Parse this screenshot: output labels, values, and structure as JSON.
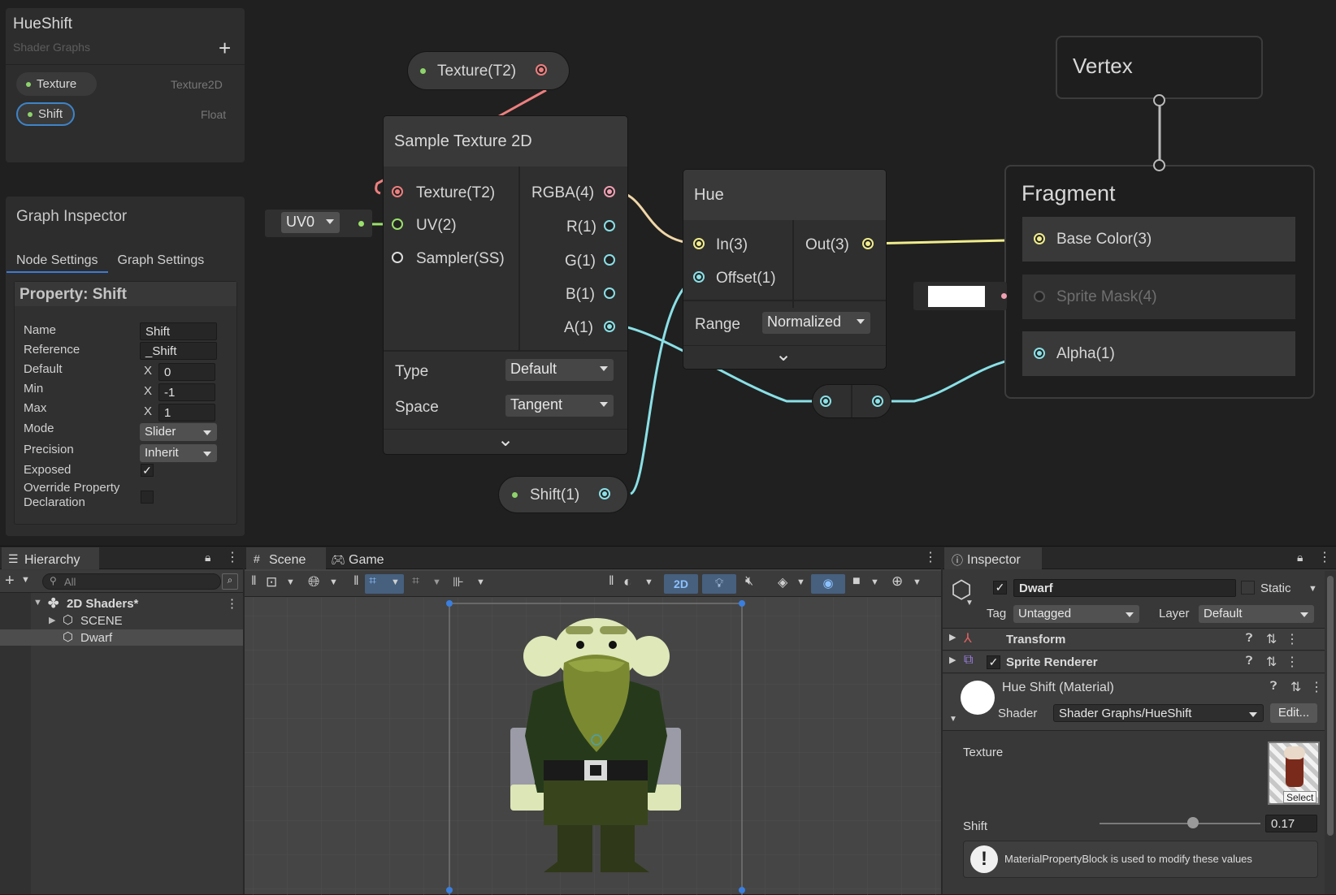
{
  "blackboard": {
    "title": "HueShift",
    "subtitle": "Shader Graphs",
    "add": "+",
    "props": [
      {
        "name": "Texture",
        "type": "Texture2D"
      },
      {
        "name": "Shift",
        "type": "Float"
      }
    ]
  },
  "inspector": {
    "title": "Graph Inspector",
    "tabs": [
      "Node Settings",
      "Graph Settings"
    ],
    "header": "Property: Shift",
    "fields": {
      "name": {
        "label": "Name",
        "value": "Shift"
      },
      "reference": {
        "label": "Reference",
        "value": "_Shift"
      },
      "default": {
        "label": "Default",
        "axis": "X",
        "value": "0"
      },
      "min": {
        "label": "Min",
        "axis": "X",
        "value": "-1"
      },
      "max": {
        "label": "Max",
        "axis": "X",
        "value": "1"
      },
      "mode": {
        "label": "Mode",
        "value": "Slider"
      },
      "precision": {
        "label": "Precision",
        "value": "Inherit"
      },
      "exposed": {
        "label": "Exposed",
        "check": "✓"
      },
      "override": {
        "label": "Override Property\nDeclaration"
      }
    }
  },
  "nodes": {
    "texture_prop": "Texture(T2)",
    "uv": "UV0",
    "shift_prop": "Shift(1)",
    "sample": {
      "title": "Sample Texture 2D",
      "inputs": [
        "Texture(T2)",
        "UV(2)",
        "Sampler(SS)"
      ],
      "outputs": [
        "RGBA(4)",
        "R(1)",
        "G(1)",
        "B(1)",
        "A(1)"
      ],
      "type_label": "Type",
      "type_value": "Default",
      "space_label": "Space",
      "space_value": "Tangent",
      "expand": "⌄"
    },
    "hue": {
      "title": "Hue",
      "inputs": [
        "In(3)",
        "Offset(1)"
      ],
      "output": "Out(3)",
      "range_label": "Range",
      "range_value": "Normalized",
      "expand": "⌄"
    },
    "vertex": "Vertex",
    "fragment": {
      "title": "Fragment",
      "slots": [
        "Base Color(3)",
        "Sprite Mask(4)",
        "Alpha(1)"
      ]
    }
  },
  "colors": {
    "vec4": "#f09fb2",
    "vec3": "#f0ec8c",
    "float": "#8ae0e6",
    "tex": "#ee7f7f",
    "uv": "#9be06b"
  },
  "hierarchy": {
    "tab": "Hierarchy",
    "search": "All",
    "scene": "2D Shaders*",
    "items": [
      "SCENE",
      "Dwarf"
    ]
  },
  "scene_view": {
    "tabs": [
      "Scene",
      "Game"
    ],
    "mode2d": "2D"
  },
  "obj_inspector": {
    "tab": "Inspector",
    "object_name": "Dwarf",
    "static_label": "Static",
    "tag_label": "Tag",
    "tag_value": "Untagged",
    "layer_label": "Layer",
    "layer_value": "Default",
    "components": [
      "Transform",
      "Sprite Renderer"
    ],
    "material": "Hue Shift (Material)",
    "shader_label": "Shader",
    "shader_value": "Shader Graphs/HueShift",
    "edit": "Edit...",
    "texture_label": "Texture",
    "select": "Select",
    "shift_label": "Shift",
    "shift_value": "0.17",
    "shift_fraction": 0.58,
    "warning": "MaterialPropertyBlock is used to modify these values"
  }
}
